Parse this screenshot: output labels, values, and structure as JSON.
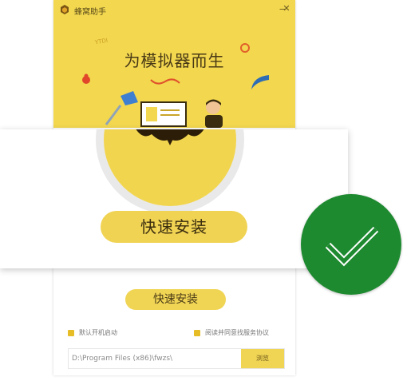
{
  "window": {
    "title": "蜂窝助手",
    "minimize_glyph": "−",
    "close_glyph": "✕"
  },
  "banner": {
    "headline": "为模拟器而生",
    "background_color": "#f2d74f",
    "sticker_text": "YTDI"
  },
  "install": {
    "zoomed_button_label": "快速安装",
    "button_label": "快速安装",
    "option_autostart_label": "默认开机启动",
    "option_agreement_label": "阅读并同意找服务协议",
    "install_path_value": "D:\\Program Files (x86)\\fwzs\\",
    "browse_label": "浏览"
  },
  "success_badge": {
    "icon": "checkmark-icon",
    "color": "#1e8a30"
  }
}
